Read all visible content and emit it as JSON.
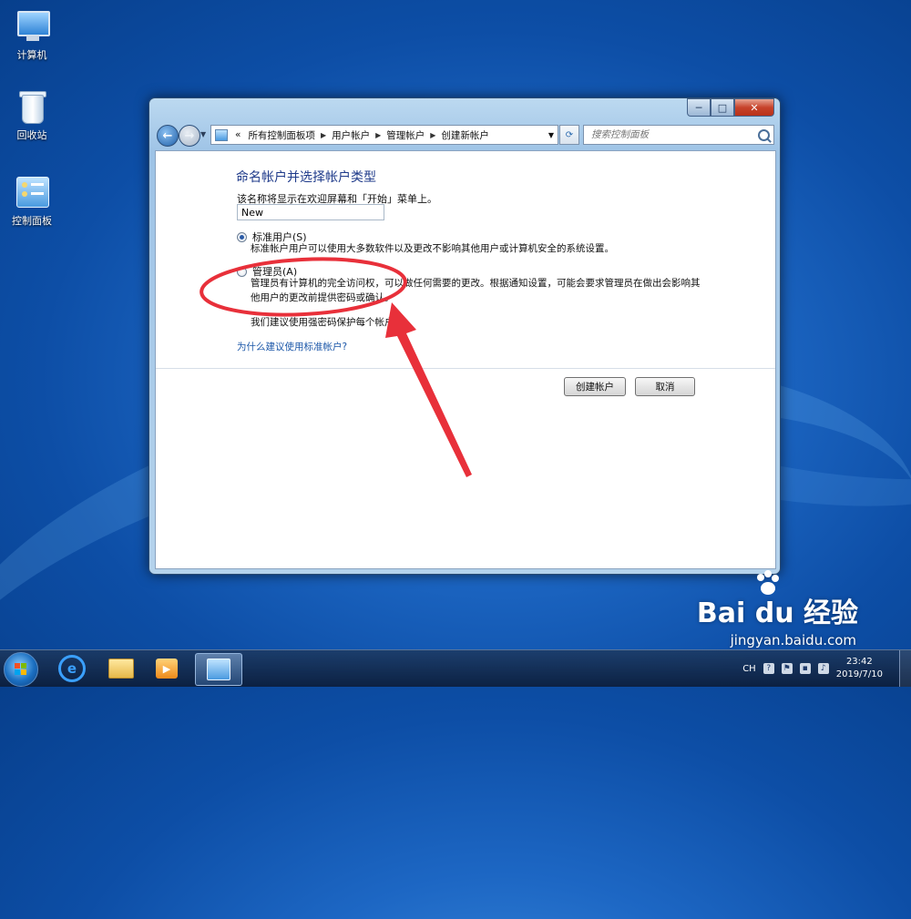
{
  "desktop": {
    "icons": [
      {
        "label": "计算机"
      },
      {
        "label": "回收站"
      },
      {
        "label": "控制面板"
      }
    ]
  },
  "window": {
    "controls": {
      "minimize": "─",
      "maximize": "□",
      "close": "✕"
    },
    "address": {
      "prefix": "«",
      "crumbs": [
        "所有控制面板项",
        "用户帐户",
        "管理帐户",
        "创建新帐户"
      ]
    },
    "search": {
      "placeholder": "搜索控制面板"
    }
  },
  "form": {
    "title": "命名帐户并选择帐户类型",
    "name_desc": "该名称将显示在欢迎屏幕和「开始」菜单上。",
    "name_value": "New",
    "options": [
      {
        "label": "标准用户(S)",
        "desc": "标准帐户用户可以使用大多数软件以及更改不影响其他用户或计算机安全的系统设置。",
        "checked": true
      },
      {
        "label": "管理员(A)",
        "desc": "管理员有计算机的完全访问权，可以做任何需要的更改。根据通知设置，可能会要求管理员在做出会影响其他用户的更改前提供密码或确认。",
        "checked": false
      }
    ],
    "recommend": "我们建议使用强密码保护每个帐户。",
    "help_link": "为什么建议使用标准帐户?",
    "create_button": "创建帐户",
    "cancel_button": "取消"
  },
  "annotation": {
    "color": "#e8303a"
  },
  "taskbar": {
    "tray": {
      "lang": "CH",
      "time": "23:42",
      "date": "2019/7/10"
    }
  },
  "watermark": {
    "brand": "Bai du 经验",
    "url": "jingyan.baidu.com"
  }
}
